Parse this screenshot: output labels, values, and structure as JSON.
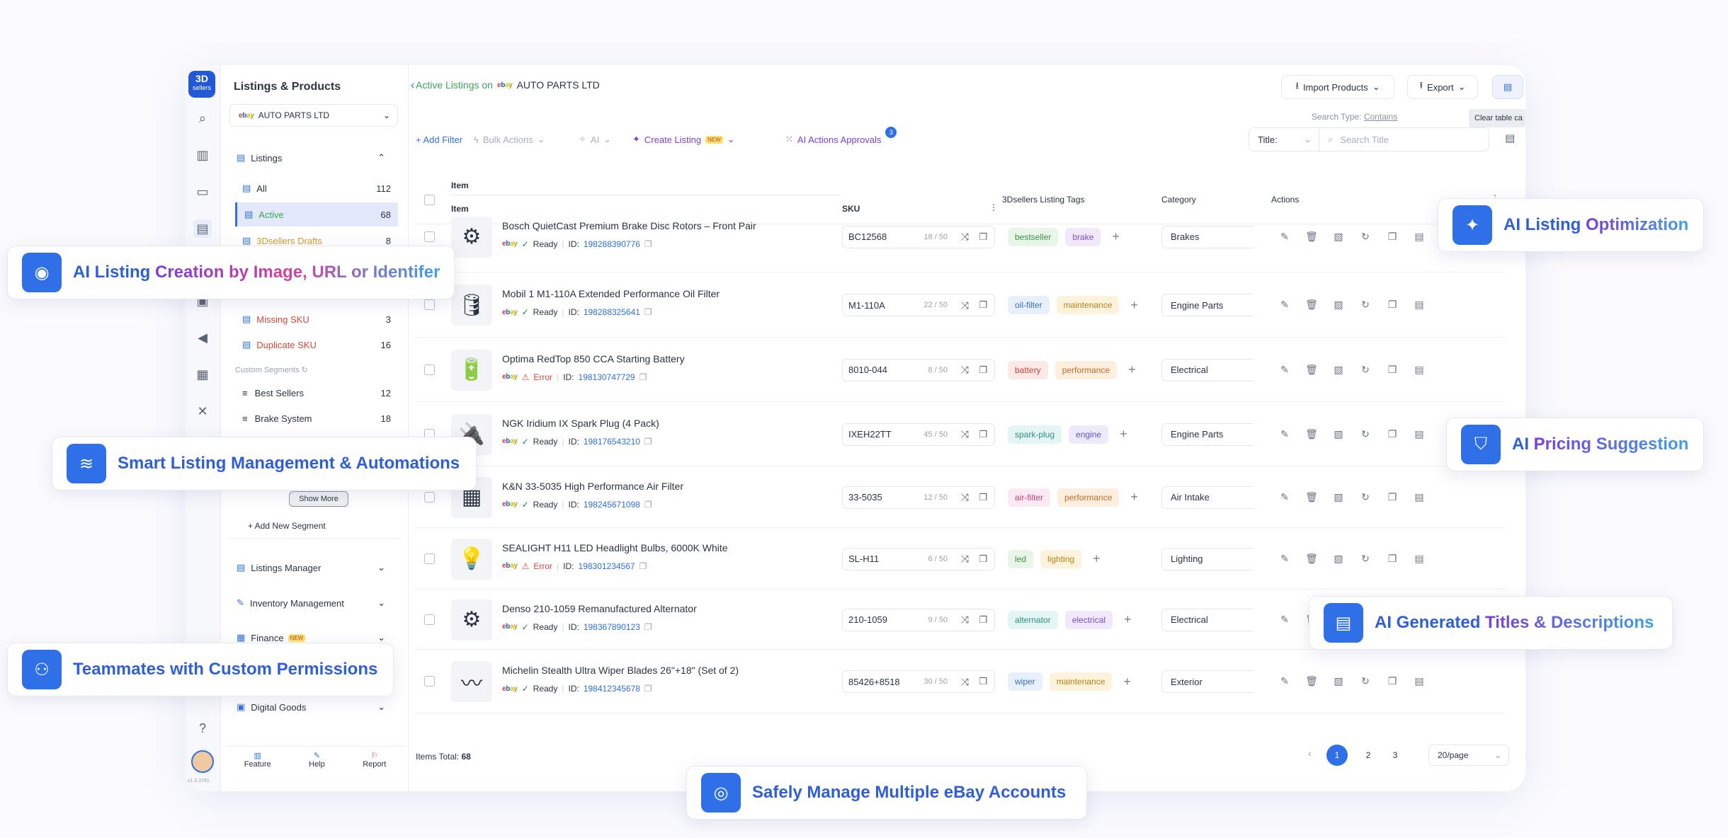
{
  "brand": {
    "logo_top": "3D",
    "logo_bottom": "sellers",
    "version": "v1.0.3781"
  },
  "sidebar": {
    "title": "Listings & Products",
    "account": "AUTO PARTS LTD",
    "listings_header": "Listings",
    "items": [
      {
        "label": "All",
        "count": "112"
      },
      {
        "label": "Active",
        "count": "68"
      },
      {
        "label": "3Dsellers Drafts",
        "count": "8"
      },
      {
        "label": "Missing SKU",
        "count": "3"
      },
      {
        "label": "Duplicate SKU",
        "count": "16"
      }
    ],
    "custom_segments_label": "Custom Segments",
    "segments": [
      {
        "label": "Best Sellers",
        "count": "12"
      },
      {
        "label": "Brake System",
        "count": "18"
      }
    ],
    "show_more": "Show More",
    "add_segment": "+ Add New Segment",
    "sections": [
      "Listings Manager",
      "Inventory Management",
      "Finance",
      "Digital Goods"
    ],
    "finance_badge": "NEW",
    "footer": [
      "Feature",
      "Help",
      "Report"
    ]
  },
  "header": {
    "title_prefix": "Active Listings on",
    "account": "AUTO PARTS LTD",
    "import": "Import Products",
    "export": "Export",
    "tooltip": "Clear table ca"
  },
  "toolbar": {
    "add_filter": "+ Add Filter",
    "bulk_actions": "Bulk Actions",
    "ai": "AI",
    "create_listing": "Create Listing",
    "new_badge": "NEW",
    "ai_approvals": "AI Actions Approvals",
    "ai_approvals_count": "3",
    "search_type_label": "Search Type:",
    "search_type_value": "Contains",
    "title_select": "Title:",
    "search_placeholder": "Search Title"
  },
  "table": {
    "group_header": "Item",
    "headers": [
      "Item",
      "SKU",
      "3Dsellers Listing Tags",
      "Category",
      "Actions"
    ],
    "rows": [
      {
        "title": "Bosch QuietCast Premium Brake Disc Rotors – Front Pair",
        "status": "Ready",
        "id_label": "ID:",
        "id": "198288390776",
        "sku": "BC12568",
        "sku_count": "18 / 50",
        "tags": [
          {
            "t": "bestseller",
            "c": "#e8f6e9",
            "f": "#3f8f4a"
          },
          {
            "t": "brake",
            "c": "#f1e9fb",
            "f": "#7a4bc6"
          }
        ],
        "category": "Brakes",
        "thumb": "⚙"
      },
      {
        "title": "Mobil 1 M1-110A Extended Performance Oil Filter",
        "status": "Ready",
        "id_label": "ID:",
        "id": "198288325641",
        "sku": "M1-110A",
        "sku_count": "22 / 50",
        "tags": [
          {
            "t": "oil-filter",
            "c": "#e7f0fb",
            "f": "#3a6fb3"
          },
          {
            "t": "maintenance",
            "c": "#fdf3dc",
            "f": "#b9801a"
          }
        ],
        "category": "Engine Parts",
        "thumb": "🛢"
      },
      {
        "title": "Optima RedTop 850 CCA Starting Battery",
        "status": "Error",
        "id_label": "ID:",
        "id": "198130747729",
        "sku": "8010-044",
        "sku_count": "8 / 50",
        "tags": [
          {
            "t": "battery",
            "c": "#fde8e8",
            "f": "#c0463f"
          },
          {
            "t": "performance",
            "c": "#fdeede",
            "f": "#c26a2a"
          }
        ],
        "category": "Electrical",
        "thumb": "🔋"
      },
      {
        "title": "NGK Iridium IX Spark Plug (4 Pack)",
        "status": "Ready",
        "id_label": "ID:",
        "id": "198176543210",
        "sku": "IXEH22TT",
        "sku_count": "45 / 50",
        "tags": [
          {
            "t": "spark-plug",
            "c": "#e3f6f3",
            "f": "#2f8f82"
          },
          {
            "t": "engine",
            "c": "#eceafb",
            "f": "#5a56c0"
          }
        ],
        "category": "Engine Parts",
        "thumb": "🔌"
      },
      {
        "title": "K&N 33-5035 High Performance Air Filter",
        "status": "Ready",
        "id_label": "ID:",
        "id": "198245671098",
        "sku": "33-5035",
        "sku_count": "12 / 50",
        "tags": [
          {
            "t": "air-filter",
            "c": "#fbe9f3",
            "f": "#b8467f"
          },
          {
            "t": "performance",
            "c": "#fdeede",
            "f": "#c26a2a"
          }
        ],
        "category": "Air Intake",
        "thumb": "▦"
      },
      {
        "title": "SEALIGHT H11 LED Headlight Bulbs, 6000K White",
        "status": "Error",
        "id_label": "ID:",
        "id": "198301234567",
        "sku": "SL-H11",
        "sku_count": "6 / 50",
        "tags": [
          {
            "t": "led",
            "c": "#e8f6e9",
            "f": "#3f8f4a"
          },
          {
            "t": "lighting",
            "c": "#fdf3dc",
            "f": "#b9801a"
          }
        ],
        "category": "Lighting",
        "thumb": "💡"
      },
      {
        "title": "Denso 210-1059 Remanufactured Alternator",
        "status": "Ready",
        "id_label": "ID:",
        "id": "198367890123",
        "sku": "210-1059",
        "sku_count": "9 / 50",
        "tags": [
          {
            "t": "alternator",
            "c": "#e3f6f3",
            "f": "#2f8f82"
          },
          {
            "t": "electrical",
            "c": "#f1e9fb",
            "f": "#7a4bc6"
          }
        ],
        "category": "Electrical",
        "thumb": "⚙"
      },
      {
        "title": "Michelin Stealth Ultra Wiper Blades 26\"+18\" (Set of 2)",
        "status": "Ready",
        "id_label": "ID:",
        "id": "198412345678",
        "sku": "85426+8518",
        "sku_count": "30 / 50",
        "tags": [
          {
            "t": "wiper",
            "c": "#e7f0fb",
            "f": "#3a6fb3"
          },
          {
            "t": "maintenance",
            "c": "#fdf3dc",
            "f": "#b9801a"
          }
        ],
        "category": "Exterior",
        "thumb": "〰"
      }
    ]
  },
  "footer": {
    "items_total_label": "Items Total:",
    "items_total": "68",
    "pages": [
      "1",
      "2",
      "3"
    ],
    "per_page": "20/page"
  },
  "callouts": {
    "creation_a": "AI Listing ",
    "creation_b": "Creation by Image, URL or Identifer",
    "smart": "Smart Listing Management & Automations",
    "teammates": "Teammates with Custom Permissions",
    "optimization_a": "AI Listing ",
    "optimization_b": "Optimization",
    "pricing_a": "AI ",
    "pricing_b": "Pricing Suggestion",
    "titles_a": "AI Generated ",
    "titles_b": "Titles & Descriptions",
    "safely": "Safely Manage Multiple eBay Accounts"
  },
  "colors": {
    "accent": "#2f6fe8",
    "active_bg": "#e3e9fb",
    "error": "#d9453b",
    "ready": "#2b7a3f"
  }
}
